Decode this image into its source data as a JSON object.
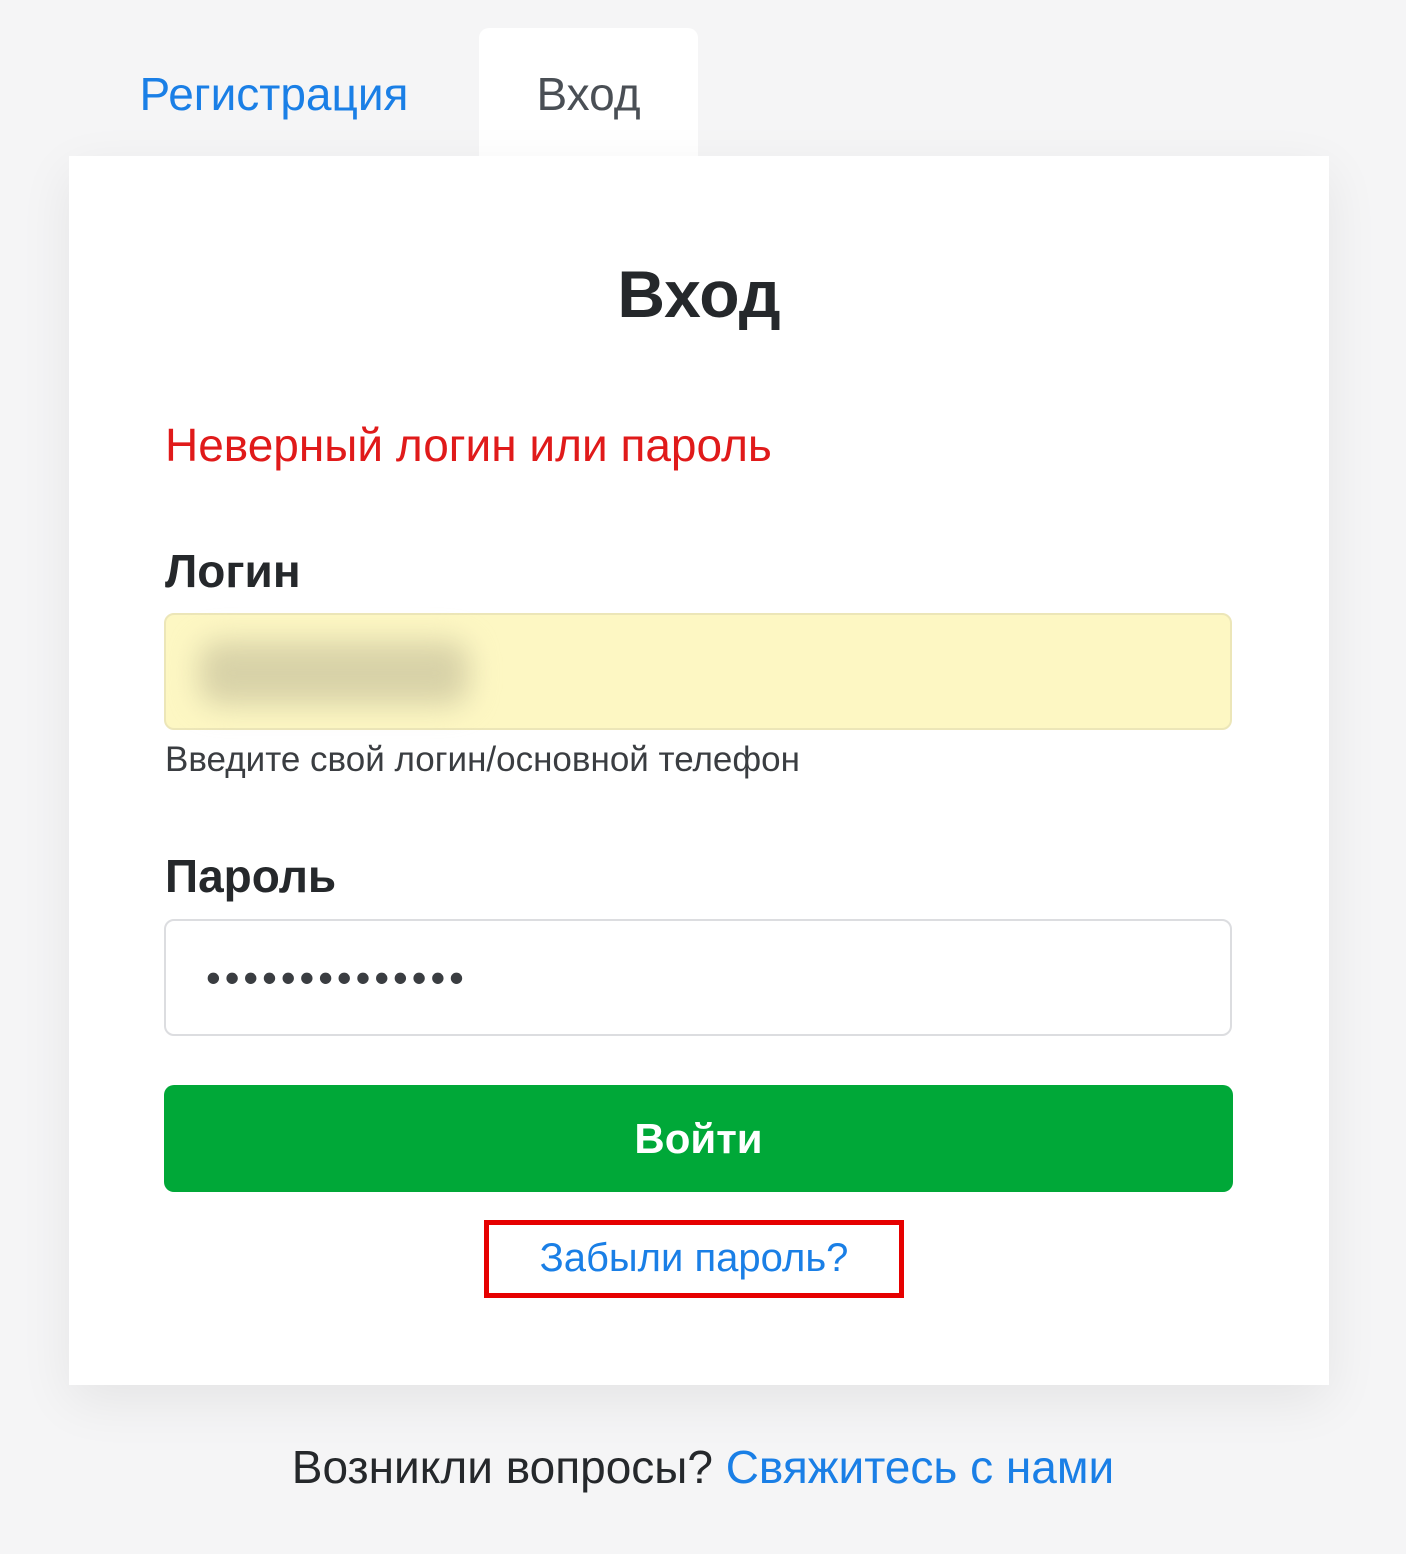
{
  "tabs": {
    "register": "Регистрация",
    "login": "Вход"
  },
  "card": {
    "title": "Вход",
    "error": "Неверный логин или пароль",
    "login_label": "Логин",
    "login_hint": "Введите свой логин/основной телефон",
    "password_label": "Пароль",
    "password_value": "••••••••••••••",
    "submit_label": "Войти",
    "forgot_label": "Забыли пароль?"
  },
  "footer": {
    "question": "Возникли вопросы?",
    "contact_link": "Свяжитесь с нами"
  },
  "colors": {
    "accent_link": "#1a7fe6",
    "error": "#e01a1a",
    "submit": "#00a838",
    "highlight_box": "#e60000",
    "autofill": "#fdf7c3"
  }
}
